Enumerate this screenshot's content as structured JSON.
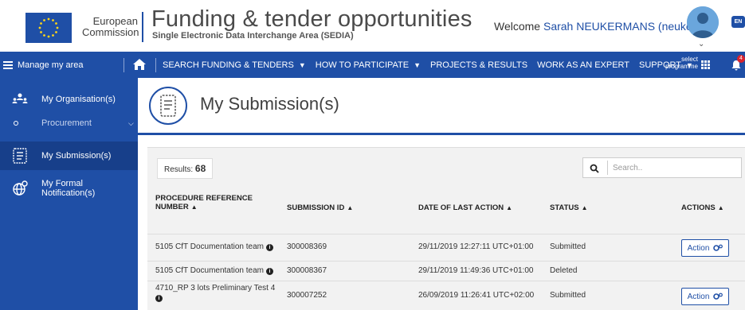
{
  "header": {
    "org_name_line1": "European",
    "org_name_line2": "Commission",
    "site_title": "Funding & tender opportunities",
    "site_subtitle": "Single Electronic Data Interchange Area (SEDIA)",
    "welcome_prefix": "Welcome",
    "user_name": "Sarah NEUKERMANS (neukesa)",
    "language": "EN",
    "brand_color": "#1f4fa6"
  },
  "topnav": {
    "manage_label": "Manage my area",
    "items": [
      {
        "label": "SEARCH FUNDING & TENDERS",
        "has_caret": true
      },
      {
        "label": "HOW TO PARTICIPATE",
        "has_caret": true
      },
      {
        "label": "PROJECTS & RESULTS",
        "has_caret": false
      },
      {
        "label": "WORK AS AN EXPERT",
        "has_caret": false
      },
      {
        "label": "SUPPORT",
        "has_caret": true
      }
    ],
    "select_programme_line1": "select",
    "select_programme_line2": "programme",
    "notification_count": "4"
  },
  "sidebar": {
    "items": [
      {
        "label": "My Organisation(s)",
        "icon": "organisation-icon"
      },
      {
        "label": "Procurement",
        "icon": "dot-icon"
      },
      {
        "label": "My Submission(s)",
        "icon": "submission-icon",
        "active": true
      },
      {
        "label": "My Formal Notification(s)",
        "icon": "notification-globe-icon"
      }
    ]
  },
  "main": {
    "page_title": "My Submission(s)",
    "results_label": "Results:",
    "results_count": "68",
    "search_placeholder": "Search..",
    "columns": [
      {
        "line1": "PROCEDURE REFERENCE",
        "line2": "NUMBER"
      },
      {
        "line1": "SUBMISSION ID"
      },
      {
        "line1": "DATE OF LAST ACTION"
      },
      {
        "line1": "STATUS"
      },
      {
        "line1": "ACTIONS"
      }
    ],
    "rows": [
      {
        "reference": "5105 CfT Documentation team",
        "submission_id": "300008369",
        "date": "29/11/2019 12:27:11 UTC+01:00",
        "status": "Submitted",
        "action": "Action"
      },
      {
        "reference": "5105 CfT Documentation team",
        "submission_id": "300008367",
        "date": "29/11/2019 11:49:36 UTC+01:00",
        "status": "Deleted",
        "action": ""
      },
      {
        "reference": "4710_RP 3 lots Preliminary Test 4",
        "submission_id": "300007252",
        "date": "26/09/2019 11:26:41 UTC+02:00",
        "status": "Submitted",
        "action": "Action"
      }
    ]
  }
}
